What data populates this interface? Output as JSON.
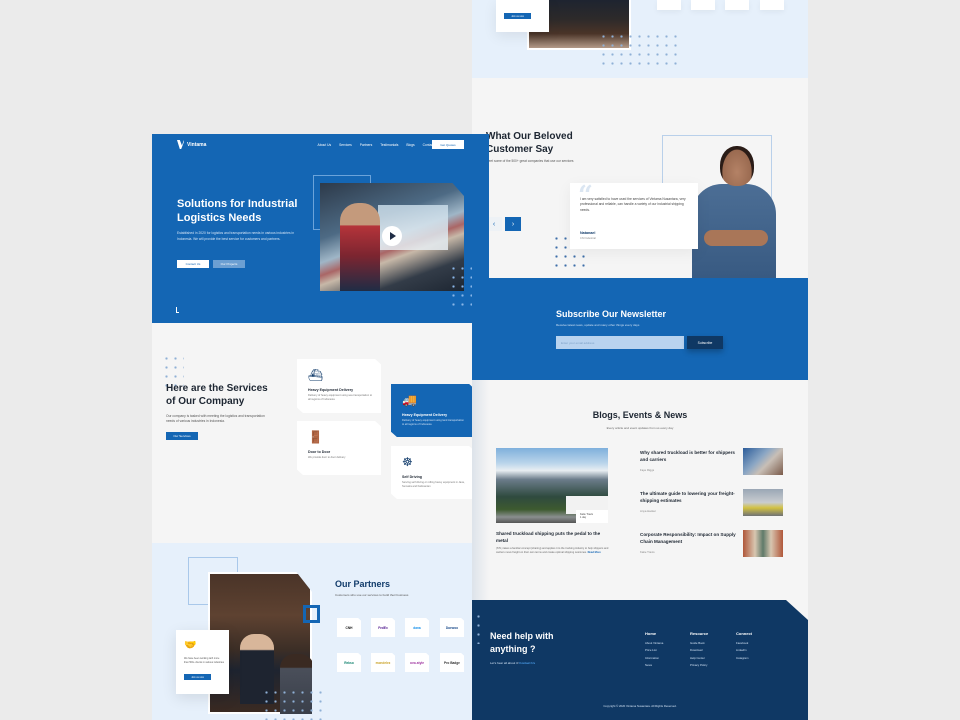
{
  "colors": {
    "primary": "#1466b4",
    "dark": "#0f3864",
    "bg": "#f5f5f5",
    "light_blue": "#e6f0fb"
  },
  "brand": {
    "name": "Vintama"
  },
  "nav": {
    "links": [
      "About Us",
      "Services",
      "Partners",
      "Testimonials",
      "Blogs",
      "Contact"
    ],
    "cta": "Get Quotes"
  },
  "hero": {
    "title": "Solutions for Industrial Logistics Needs",
    "description": "Established in 2020 for logistics and transportation needs in various industries in Indonesia. We will provide the best service for customers and partners.",
    "primary_button": "Contact Us",
    "secondary_button": "Our Projects",
    "video_icon": "play-icon"
  },
  "services": {
    "title": "Here are the Services of Our Company",
    "description": "Our company is tasked with meeting the logistics and transportation needs of various industries in Indonesia.",
    "button": "Our Services",
    "cards": [
      {
        "icon": "ship-icon",
        "title": "Heavy Equipment Delivery",
        "text": "Delivery of heavy equipment using sea transportation to all regions of Indonesia"
      },
      {
        "icon": "door-icon",
        "title": "Door to Door",
        "text": "We provide door to door delivery"
      },
      {
        "icon": "truck-icon",
        "title": "Heavy Equipment Delivery",
        "text": "Delivery of heavy equipment using land transportation to all regions of Indonesia",
        "active": true
      },
      {
        "icon": "steering-wheel-icon",
        "title": "Self Driving",
        "text": "Serving self driving or rolling heavy equipment in Java, Sumatra and Kalimantan"
      }
    ]
  },
  "partners": {
    "title": "Our Partners",
    "description": "Customers who use our services to build their business",
    "join_card": {
      "icon": "handshake-icon",
      "text": "We have been working with more than 500+ clients in various industries",
      "button": "Join us now"
    },
    "logos": [
      "CNH",
      "FedEx",
      "dana",
      "Daewoo",
      "Rekso",
      "mondelez",
      "ovo-style",
      "Pro Badge"
    ]
  },
  "testimonials": {
    "title": "What Our Beloved Customer Say",
    "description": "Meet some of the 500+ great companies that use our services",
    "quote": "I am very satisfied to have used the services of Vintama Nusantara, very professional and reliable, can handle a variety of our industrial shipping needs.",
    "author": "Natanael",
    "company": "CNI Industrial",
    "prev": "‹",
    "next": "›"
  },
  "newsletter": {
    "title": "Subscribe Our Newsletter",
    "description": "Receive latest news, update and many other things every days",
    "placeholder": "Enter your email address",
    "button": "Subscribe"
  },
  "blogs": {
    "title": "Blogs, Events & News",
    "description": "Every article and event updates from us every day",
    "featured": {
      "title": "Shared truckload shipping puts the pedal to the metal",
      "text": "(STL) takes a familiar concept (sharing) and applies it to the trucking industry to help shippers and carriers move freight on their own terms and create optimal shipping outcomes.",
      "read_more": "Read More",
      "author": "Katie Travis",
      "date": "1 day"
    },
    "items": [
      {
        "title": "Why shared truckload is better for shippers and carriers",
        "author": "Faye Riggs"
      },
      {
        "title": "The ultimate guide to lowering your freight-shipping estimates",
        "author": "Anya Hacker"
      },
      {
        "title": "Corporate Responsibility: Impact on Supply Chain Management",
        "author": "Katie Travis"
      }
    ]
  },
  "footer": {
    "title": "Need help with anything ?",
    "contact_text": "Let's hear all about it!",
    "contact_link": "Contact Us",
    "columns": [
      {
        "heading": "Home",
        "links": [
          "About Vintama",
          "Price List",
          "Information",
          "News"
        ]
      },
      {
        "heading": "Resource",
        "links": [
          "Guide Book",
          "Download",
          "Help Center",
          "Privacy Policy"
        ]
      },
      {
        "heading": "Connect",
        "links": [
          "Facebook",
          "LinkedIn",
          "Instagram"
        ]
      }
    ],
    "copyright": "Copyright © 2020 Vintama Nusantara. All Rights Reserved."
  }
}
